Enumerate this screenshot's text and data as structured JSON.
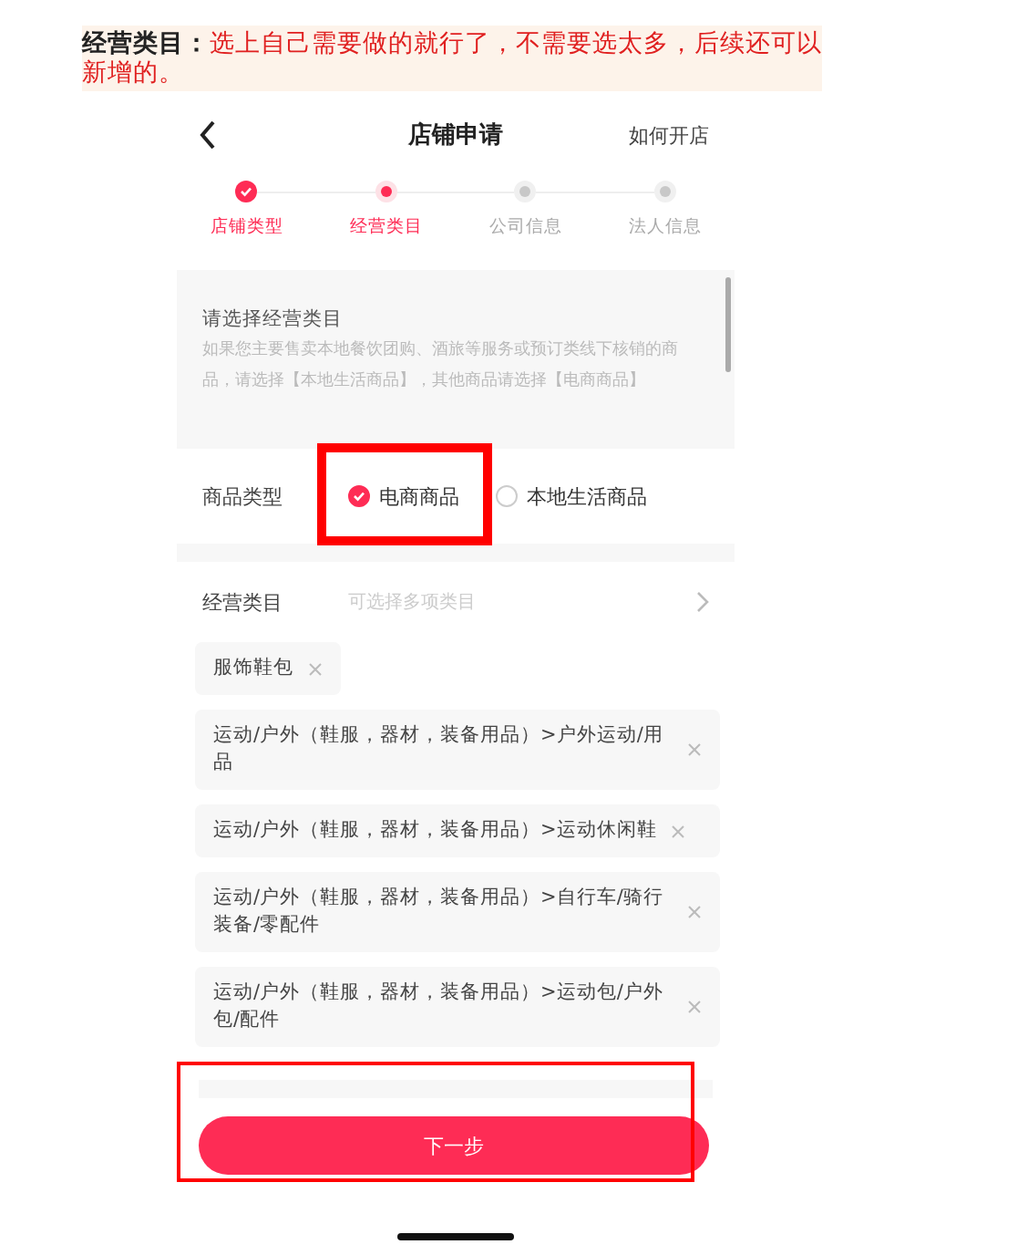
{
  "note": {
    "label": "经营类目：",
    "text": "选上自己需要做的就行了，不需要选太多，后续还可以新增的。"
  },
  "header": {
    "title": "店铺申请",
    "link": "如何开店"
  },
  "steps": [
    {
      "label": "店铺类型",
      "done": true,
      "selected": false
    },
    {
      "label": "经营类目",
      "done": false,
      "selected": true
    },
    {
      "label": "公司信息",
      "done": false,
      "selected": false
    },
    {
      "label": "法人信息",
      "done": false,
      "selected": false
    }
  ],
  "info": {
    "title": "请选择经营类目",
    "text": "如果您主要售卖本地餐饮团购、酒旅等服务或预订类线下核销的商品，请选择【本地生活商品】，其他商品请选择【电商商品】"
  },
  "product_type": {
    "label": "商品类型",
    "options": [
      {
        "label": "电商商品",
        "selected": true
      },
      {
        "label": "本地生活商品",
        "selected": false
      }
    ]
  },
  "category": {
    "label": "经营类目",
    "placeholder": "可选择多项类目"
  },
  "chips": [
    "服饰鞋包",
    "运动/户外（鞋服，器材，装备用品）>户外运动/用品",
    "运动/户外（鞋服，器材，装备用品）>运动休闲鞋",
    "运动/户外（鞋服，器材，装备用品）>自行车/骑行装备/零配件",
    "运动/户外（鞋服，器材，装备用品）>运动包/户外包/配件"
  ],
  "next_button": "下一步"
}
